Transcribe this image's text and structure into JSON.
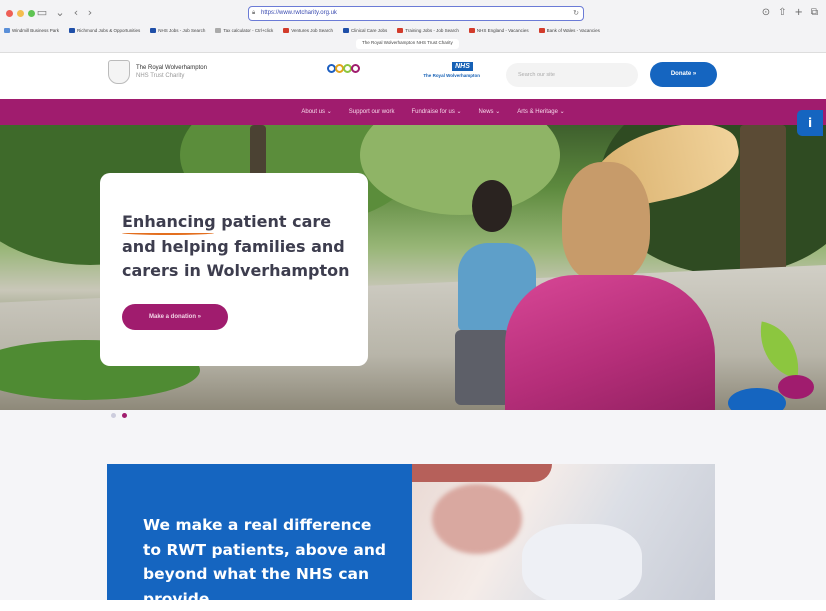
{
  "browser": {
    "url": "https://www.rwtcharity.org.uk",
    "tab_title": "The Royal Wolverhampton NHS Trust Charity",
    "bookmarks": [
      {
        "label": "Windmill Business Park",
        "color": "#5a8fd8"
      },
      {
        "label": "Richmond Jobs & Opportunities",
        "color": "#1f4fa8"
      },
      {
        "label": "NHS Jobs - Job Search",
        "color": "#1f4fa8"
      },
      {
        "label": "Tax calculator - Ctrl+click",
        "color": "#aaa"
      },
      {
        "label": "Ventures Job Search",
        "color": "#d23b2b"
      },
      {
        "label": "Clinical Care Jobs",
        "color": "#1f4fa8"
      },
      {
        "label": "Training Jobs - Job Search",
        "color": "#d23b2b"
      },
      {
        "label": "NHS England - Vacancies",
        "color": "#d23b2b"
      },
      {
        "label": "Bank of Wales - Vacancies",
        "color": "#d23b2b"
      }
    ]
  },
  "header": {
    "charity_name_line1": "The Royal Wolverhampton",
    "charity_name_line2": "NHS Trust Charity",
    "nhs_logo": "NHS",
    "nhs_trust_name": "The Royal Wolverhampton",
    "nhs_trust_sub": "NHS Trust",
    "search_placeholder": "Search our site",
    "donate_label": "Donate »",
    "ring_colors": [
      "#1c5ec0",
      "#e3a31a",
      "#8cc63f",
      "#a01c6e"
    ]
  },
  "nav": {
    "items": [
      "About us ⌄",
      "Support our work",
      "Fundraise for us ⌄",
      "News ⌄",
      "Arts & Heritage ⌄"
    ]
  },
  "hero": {
    "title": "Enhancing patient care and helping families and carers in Wolverhampton",
    "cta_label": "Make a donation »",
    "slides_total": 2,
    "slide_active": 2
  },
  "accessibility_label": "i",
  "section": {
    "text": "We make a real difference to RWT patients, above and beyond what the NHS can provide"
  },
  "colors": {
    "brand_magenta": "#a01c6e",
    "brand_blue": "#1565c0",
    "accent_orange": "#e36f1f"
  }
}
